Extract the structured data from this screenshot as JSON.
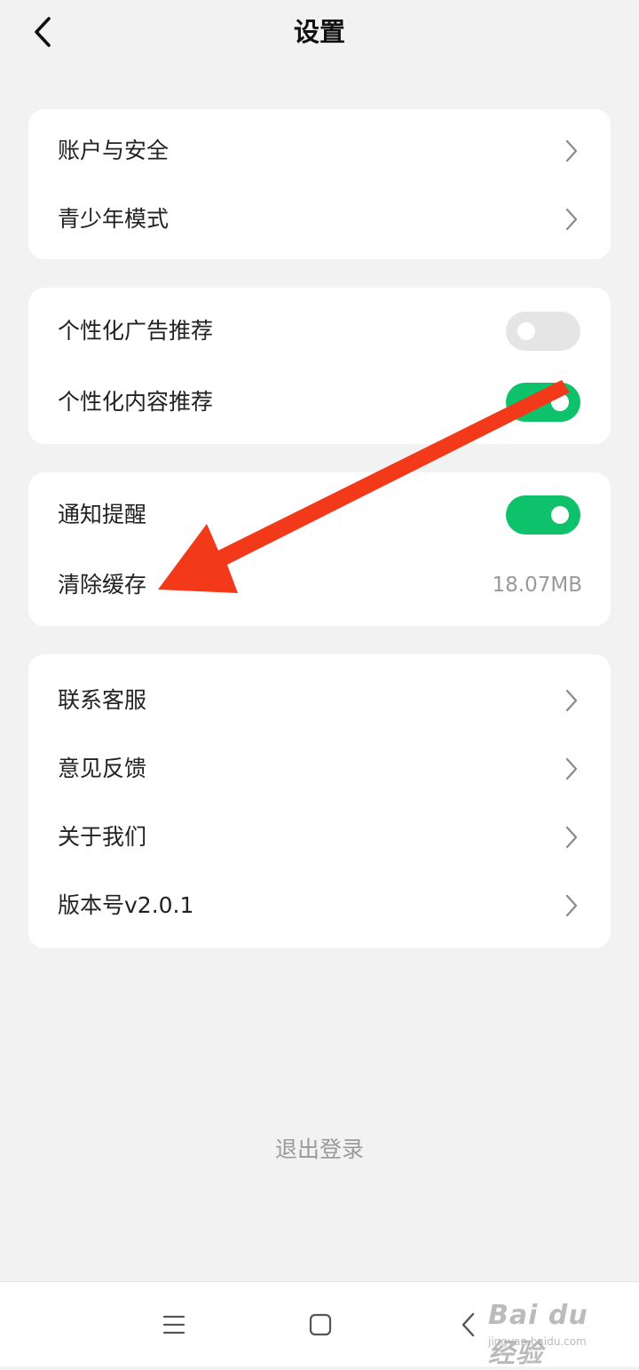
{
  "header": {
    "title": "设置",
    "back_icon": "chevron-left-icon"
  },
  "groups": {
    "account": {
      "items": [
        {
          "label": "账户与安全",
          "control": "chevron"
        },
        {
          "label": "青少年模式",
          "control": "chevron"
        }
      ]
    },
    "personalization": {
      "items": [
        {
          "label": "个性化广告推荐",
          "control": "toggle",
          "state": "off"
        },
        {
          "label": "个性化内容推荐",
          "control": "toggle",
          "state": "on"
        }
      ]
    },
    "notifications": {
      "items": [
        {
          "label": "通知提醒",
          "control": "toggle",
          "state": "on"
        },
        {
          "label": "清除缓存",
          "control": "value",
          "value": "18.07MB"
        }
      ]
    },
    "support": {
      "items": [
        {
          "label": "联系客服",
          "control": "chevron"
        },
        {
          "label": "意见反馈",
          "control": "chevron"
        },
        {
          "label": "关于我们",
          "control": "chevron"
        },
        {
          "label": "版本号v2.0.1",
          "control": "chevron"
        }
      ]
    }
  },
  "logout_label": "退出登录",
  "nav": {
    "menu_icon": "menu-icon",
    "home_icon": "square-home-icon",
    "back_icon": "triangle-back-icon"
  },
  "annotation": {
    "type": "red-arrow",
    "color": "#f23a1a"
  },
  "watermark": {
    "main": "Bai du 经验",
    "sub": "jingyan.baidu.com"
  },
  "colors": {
    "background": "#f2f2f2",
    "card": "#ffffff",
    "toggle_on": "#0ec26b",
    "toggle_off": "#e5e5e5",
    "secondary_text": "#9a9a9a"
  }
}
